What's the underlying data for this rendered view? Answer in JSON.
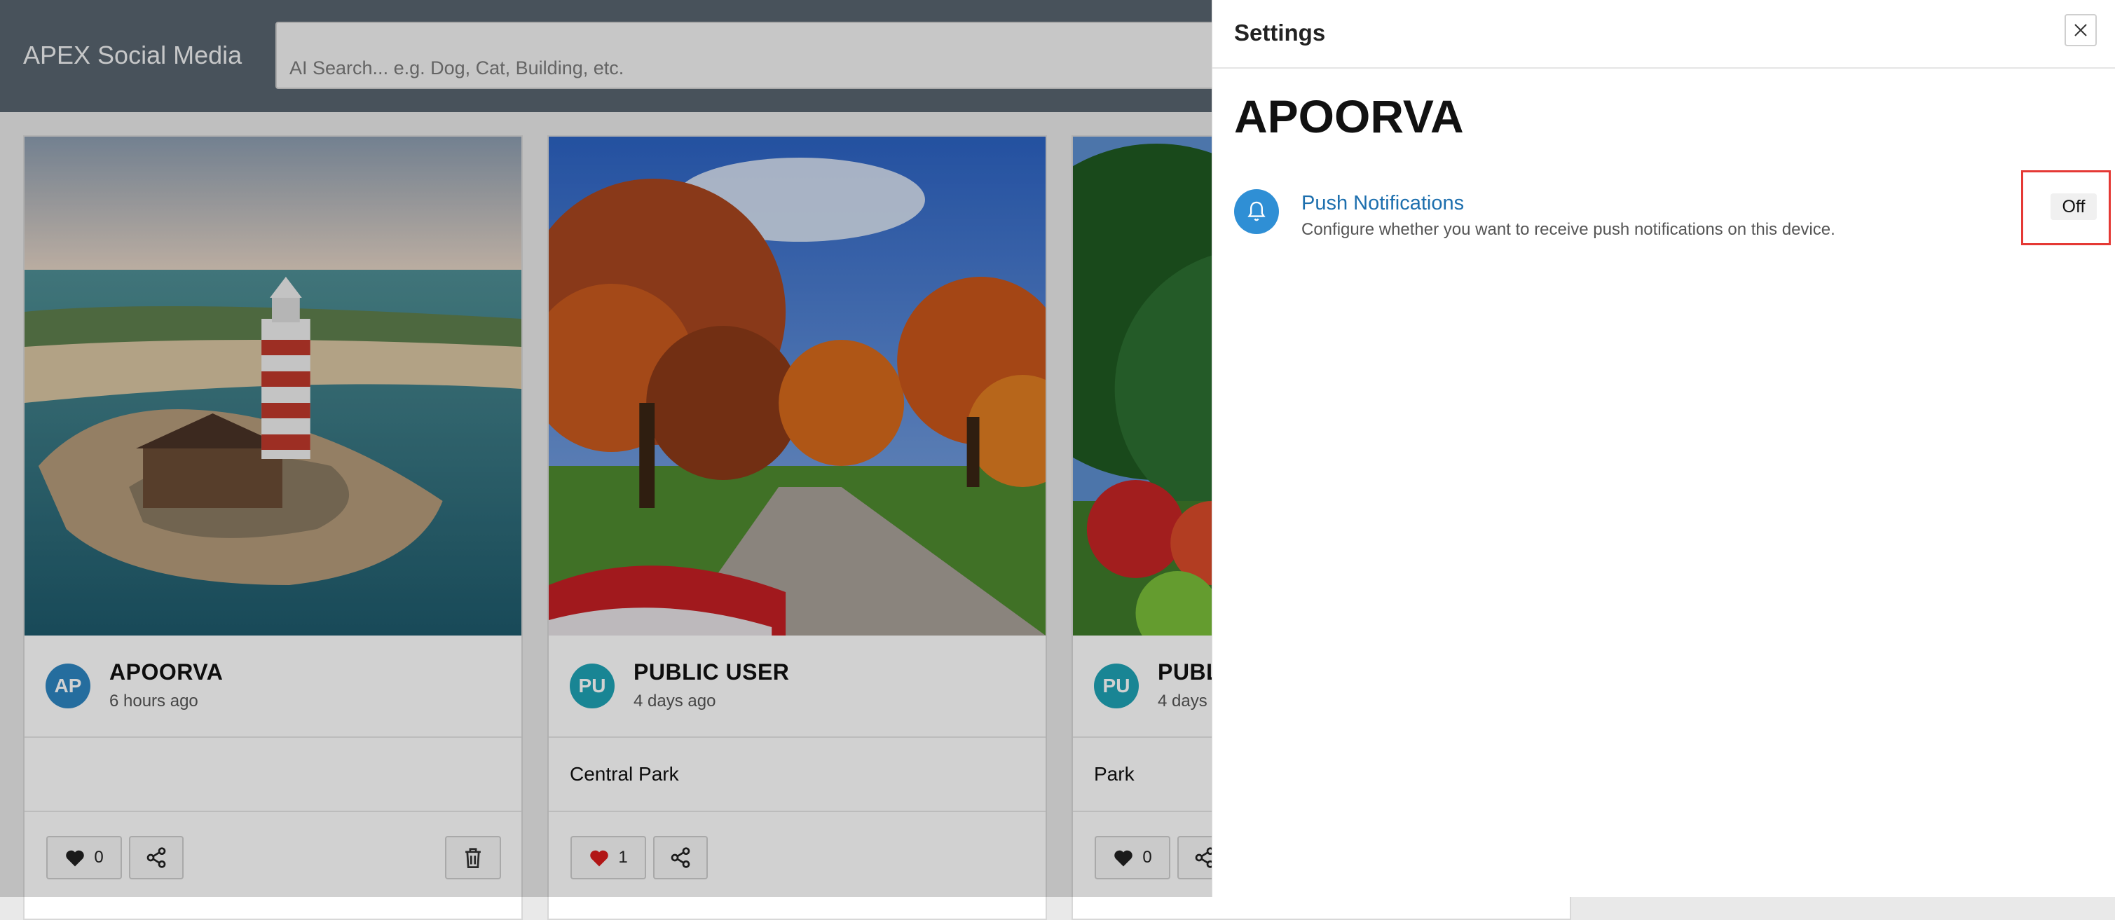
{
  "app": {
    "title": "APEX Social Media"
  },
  "search": {
    "placeholder": "AI Search... e.g. Dog, Cat, Building, etc."
  },
  "posts": [
    {
      "initials": "AP",
      "author": "APOORVA",
      "time": "6 hours ago",
      "caption": "",
      "likes": "0",
      "avatar_color": "#2e86c1",
      "liked": false
    },
    {
      "initials": "PU",
      "author": "PUBLIC USER",
      "time": "4 days ago",
      "caption": "Central Park",
      "likes": "1",
      "avatar_color": "#1fa3b5",
      "liked": true
    },
    {
      "initials": "PU",
      "author": "PUBL",
      "time": "4 days",
      "caption": "Park",
      "likes": "0",
      "avatar_color": "#1fa3b5",
      "liked": false
    }
  ],
  "settings": {
    "title": "Settings",
    "username": "APOORVA",
    "push": {
      "label": "Push Notifications",
      "description": "Configure whether you want to receive push notifications on this device.",
      "state": "Off"
    }
  },
  "colors": {
    "header": "#58646f",
    "accent": "#2f8fd5",
    "link": "#1d6fae",
    "highlight": "#e53935"
  }
}
